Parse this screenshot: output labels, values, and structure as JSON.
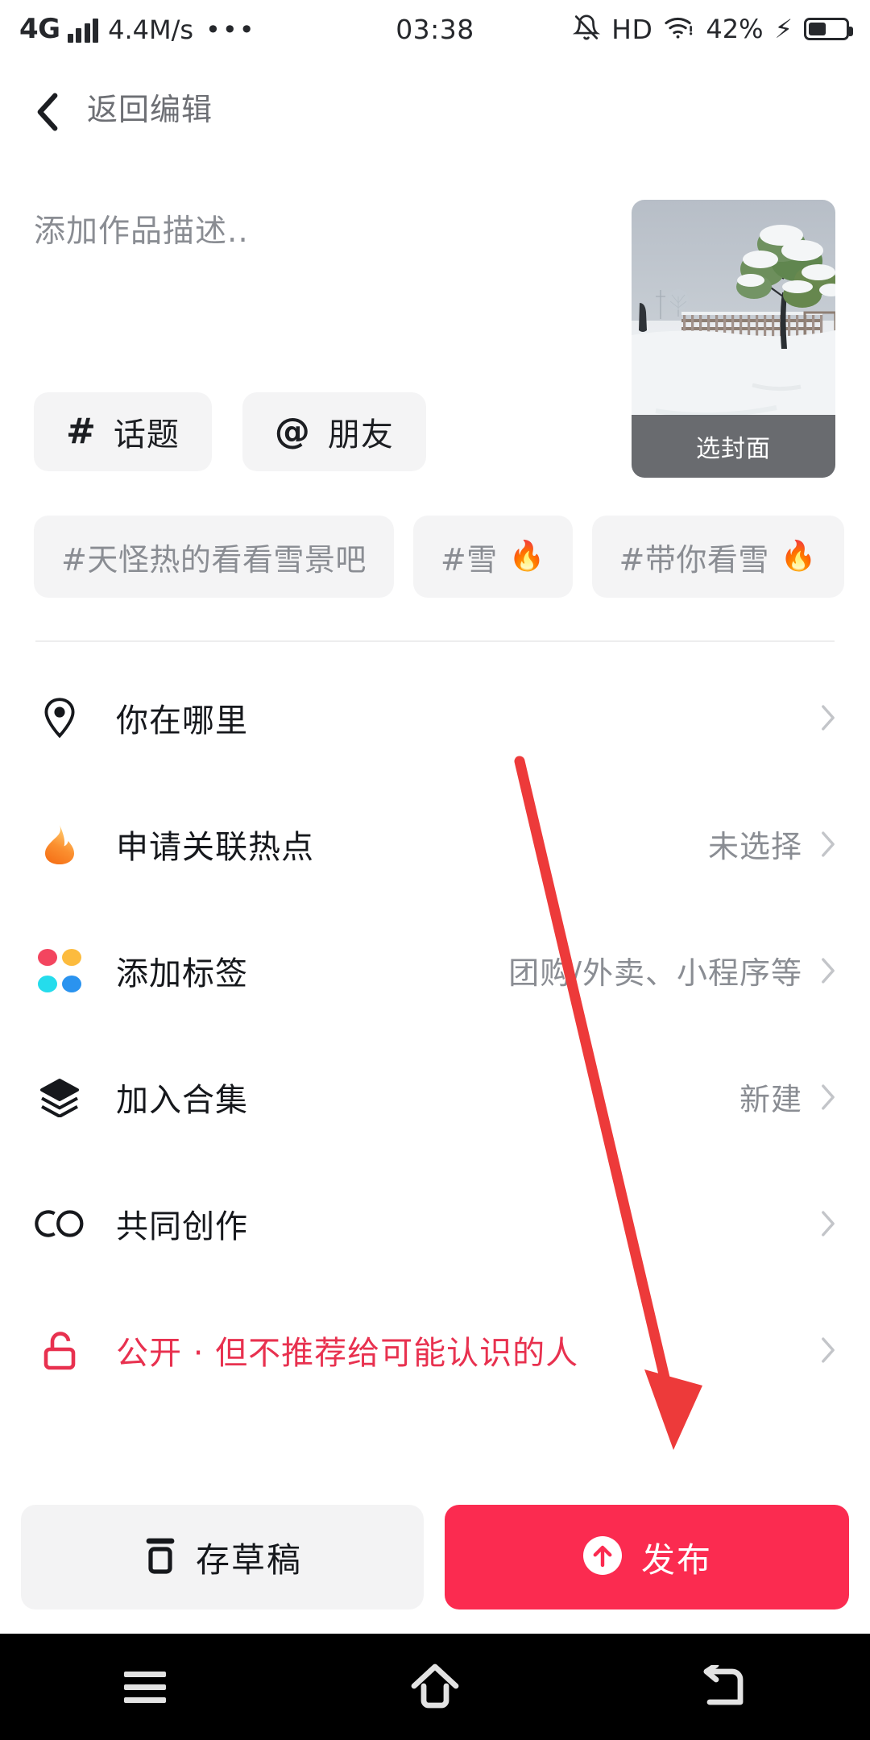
{
  "status_bar": {
    "network_type": "4G",
    "speed": "4.4M/s",
    "overflow": "•••",
    "clock": "03:38",
    "hd": "HD",
    "battery_percent": "42%",
    "signal_icon": "signal-bars-icon",
    "mute_icon": "bell-muted-icon",
    "wifi_icon": "wifi-icon",
    "charging_icon": "lightning-bolt-icon",
    "battery_icon": "battery-icon"
  },
  "header": {
    "back_icon": "chevron-left-icon",
    "back_label": "返回编辑"
  },
  "composer": {
    "description_value": "",
    "description_placeholder": "添加作品描述..",
    "cover": {
      "label": "选封面",
      "image_alt": "snow-covered-park-with-tree-and-fence"
    }
  },
  "insert_pills": [
    {
      "glyph": "#",
      "icon": "hash-icon",
      "label": "话题"
    },
    {
      "glyph": "@",
      "icon": "at-icon",
      "label": "朋友"
    }
  ],
  "hashtag_suggestions": [
    {
      "text": "#天怪热的看看雪景吧",
      "hot": false,
      "fire": ""
    },
    {
      "text": "#雪",
      "hot": true,
      "fire": "🔥"
    },
    {
      "text": "#带你看雪",
      "hot": true,
      "fire": "🔥"
    }
  ],
  "option_rows": [
    {
      "icon": "location-pin-icon",
      "label": "你在哪里",
      "value": "",
      "chevron": "chevron-right-icon",
      "accent": false
    },
    {
      "icon": "flame-icon",
      "label": "申请关联热点",
      "value": "未选择",
      "chevron": "chevron-right-icon",
      "accent": false
    },
    {
      "icon": "four-dots-icon",
      "label": "添加标签",
      "value": "团购/外卖、小程序等",
      "chevron": "chevron-right-icon",
      "accent": false
    },
    {
      "icon": "layers-icon",
      "label": "加入合集",
      "value": "新建",
      "chevron": "chevron-right-icon",
      "accent": false
    },
    {
      "icon": "co-creation-icon",
      "label": "共同创作",
      "value": "",
      "chevron": "chevron-right-icon",
      "accent": false
    },
    {
      "icon": "unlock-icon",
      "label": "公开 · 但不推荐给可能认识的人",
      "value": "",
      "chevron": "chevron-right-icon",
      "accent": true
    }
  ],
  "actions": {
    "draft_icon": "draft-box-icon",
    "draft_label": "存草稿",
    "publish_icon": "arrow-up-circle-icon",
    "publish_label": "发布"
  },
  "system_nav": {
    "menu_icon": "menu-icon",
    "home_icon": "home-icon",
    "back_icon": "back-arrow-icon"
  },
  "annotation": {
    "type": "arrow",
    "color": "#ed3a3a",
    "points_to": "publish-button"
  },
  "colors": {
    "accent_red": "#fb2b50",
    "privacy_red": "#e8314f",
    "chip_bg": "#f4f4f5",
    "muted_text": "#8a8d93",
    "primary_text": "#16181c",
    "annotation_red": "#ed3a3a"
  }
}
